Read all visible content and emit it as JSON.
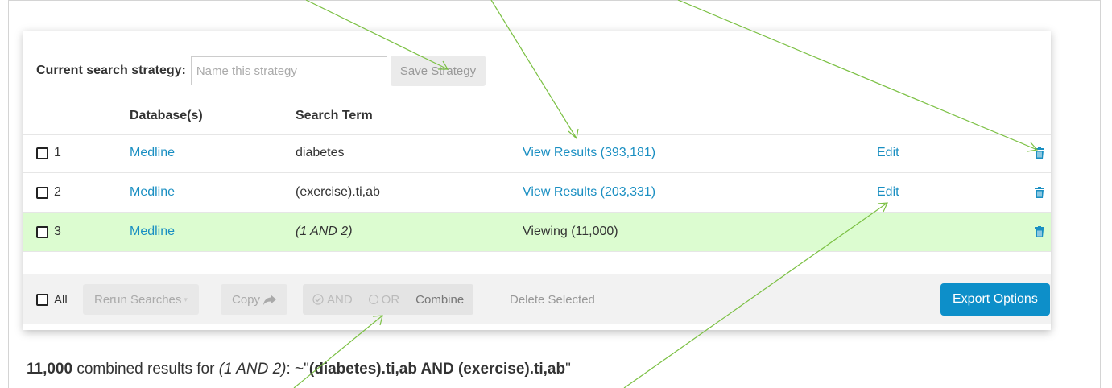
{
  "strategy": {
    "label": "Current search strategy:",
    "placeholder": "Name this strategy",
    "save_label": "Save Strategy"
  },
  "table": {
    "headers": {
      "database": "Database(s)",
      "term": "Search Term"
    },
    "rows": [
      {
        "num": "1",
        "database": "Medline",
        "term": "diabetes",
        "results": "View Results (393,181)",
        "edit": "Edit"
      },
      {
        "num": "2",
        "database": "Medline",
        "term": "(exercise).ti,ab",
        "results": "View Results (203,331)",
        "edit": "Edit"
      },
      {
        "num": "3",
        "database": "Medline",
        "term": "(1 AND 2)",
        "results": "Viewing (11,000)",
        "edit": ""
      }
    ]
  },
  "footer": {
    "all_label": "All",
    "rerun_label": "Rerun Searches",
    "copy_label": "Copy",
    "and_label": "AND",
    "or_label": "OR",
    "combine_label": "Combine",
    "delete_selected_label": "Delete Selected",
    "export_label": "Export Options"
  },
  "summary": {
    "count": "11,000",
    "text": "combined results for",
    "query_ref": "(1 AND 2)",
    "sep": ": ~\"",
    "query": "(diabetes).ti,ab AND (exercise).ti,ab",
    "end": "\""
  },
  "colors": {
    "link": "#1a8fc2",
    "highlight_row": "#dcfcd0",
    "export_button": "#0d8fc9",
    "annotation_arrow": "#7bc043"
  },
  "icons": [
    "trash-icon",
    "checkbox-icon",
    "share-arrow-icon",
    "check-circle-icon",
    "radio-icon"
  ]
}
